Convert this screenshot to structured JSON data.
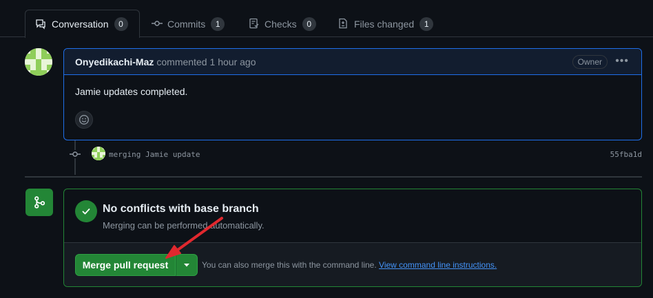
{
  "tabs": [
    {
      "label": "Conversation",
      "count": "0",
      "icon": "comment-discussion-icon"
    },
    {
      "label": "Commits",
      "count": "1",
      "icon": "git-commit-icon"
    },
    {
      "label": "Checks",
      "count": "0",
      "icon": "checklist-icon"
    },
    {
      "label": "Files changed",
      "count": "1",
      "icon": "file-diff-icon"
    }
  ],
  "comment": {
    "author": "Onyedikachi-Maz",
    "action": "commented",
    "time": "1 hour ago",
    "badge": "Owner",
    "menu": "•••",
    "body": "Jamie updates completed."
  },
  "commit": {
    "message": "merging Jamie update",
    "sha": "55fba1d"
  },
  "merge": {
    "title": "No conflicts with base branch",
    "subtitle": "Merging can be performed automatically.",
    "button": "Merge pull request",
    "hint": "You can also merge this with the command line.",
    "link": "View command line instructions."
  },
  "colors": {
    "accent_green": "#238636",
    "link_blue": "#4493f8",
    "annotation_red": "#e0282e",
    "background": "#0d1117"
  }
}
